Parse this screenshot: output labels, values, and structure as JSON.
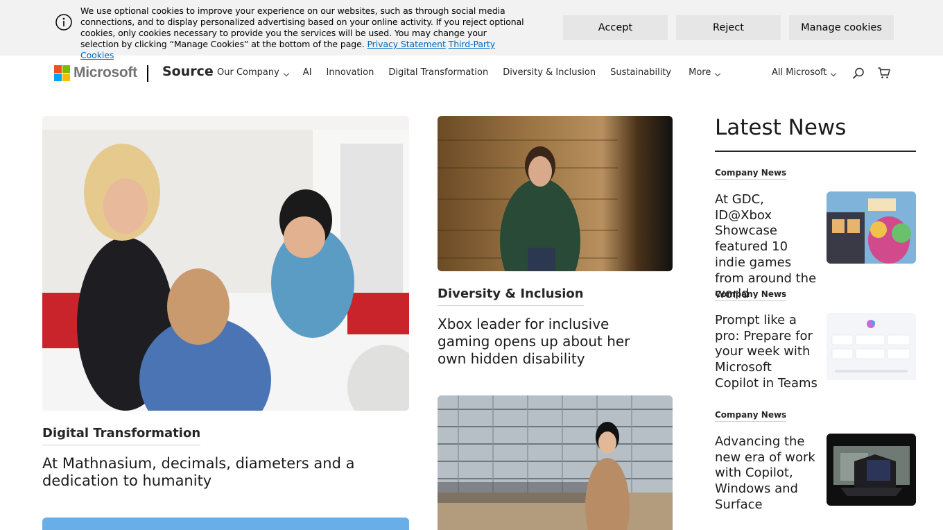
{
  "cookie_banner": {
    "message": "We use optional cookies to improve your experience on our websites, such as through social media connections, and to display personalized advertising based on your online activity. If you reject optional cookies, only cookies necessary to provide you the services will be used. You may change your selection by clicking “Manage Cookies” at the bottom of the page.",
    "privacy_link": "Privacy Statement",
    "third_party_link": "Third-Party Cookies",
    "accept_label": "Accept",
    "reject_label": "Reject",
    "manage_label": "Manage cookies",
    "icon": "info-icon"
  },
  "header": {
    "brand": "Microsoft",
    "site_title": "Source",
    "nav": [
      "Our Company",
      "AI",
      "Innovation",
      "Digital Transformation",
      "Diversity & Inclusion",
      "Sustainability",
      "More"
    ],
    "all_microsoft": "All Microsoft",
    "icons": [
      "search-icon",
      "cart-icon"
    ],
    "logo_colors": [
      "#f25022",
      "#7fba00",
      "#00a4ef",
      "#ffb900"
    ]
  },
  "main": {
    "feature": {
      "tag": "Digital Transformation",
      "headline": "At Mathnasium, decimals, diameters and a dedication to humanity"
    },
    "story2": {
      "tag": "Diversity & Inclusion",
      "headline": "Xbox leader for inclusive gaming opens up about her own hidden disability"
    }
  },
  "latest_news": {
    "title": "Latest News",
    "items": [
      {
        "category": "Company News",
        "headline": "At GDC, ID@Xbox Showcase featured 10 indie games from around the world"
      },
      {
        "category": "Company News",
        "headline": "Prompt like a pro: Prepare for your week with Microsoft Copilot in Teams"
      },
      {
        "category": "Company News",
        "headline": "Advancing the new era of work with Copilot, Windows and Surface"
      }
    ]
  }
}
